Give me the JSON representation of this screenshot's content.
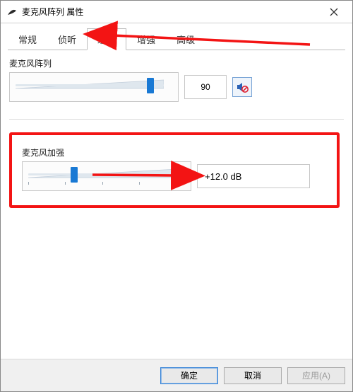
{
  "window": {
    "title": "麦克风阵列 属性"
  },
  "tabs": {
    "items": [
      {
        "label": "常规"
      },
      {
        "label": "侦听"
      },
      {
        "label": "级别",
        "active": true
      },
      {
        "label": "增强"
      },
      {
        "label": "高级"
      }
    ]
  },
  "section1": {
    "label": "麦克风阵列",
    "value": "90",
    "slider_percent": 90,
    "mute_icon": "speaker-mute-icon"
  },
  "section2": {
    "label": "麦克风加强",
    "value": "+12.0 dB",
    "slider_percent": 30
  },
  "buttons": {
    "ok": "确定",
    "cancel": "取消",
    "apply": "应用(A)"
  },
  "colors": {
    "highlight": "#f31414",
    "accent": "#1979d4"
  }
}
